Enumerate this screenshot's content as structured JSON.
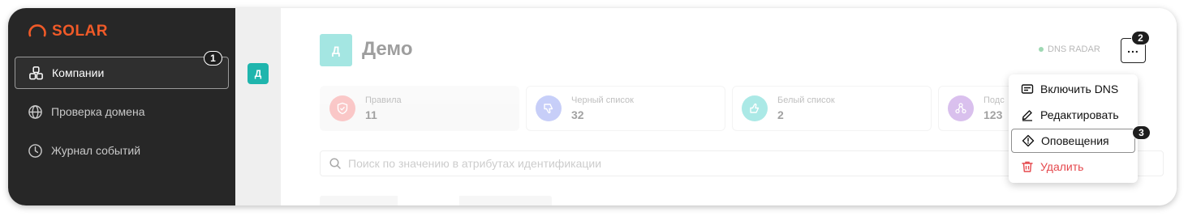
{
  "colors": {
    "accent": "#f05a28",
    "sidebar_bg": "#272727",
    "teal": "#26c3b9",
    "danger": "#e5484d",
    "status_ok": "#1aa34a"
  },
  "sidebar": {
    "logo": "SOLAR",
    "items": [
      {
        "label": "Компании",
        "icon": "blocks-icon",
        "active": true
      },
      {
        "label": "Проверка домена",
        "icon": "globe-icon"
      },
      {
        "label": "Журнал событий",
        "icon": "clock-icon"
      }
    ]
  },
  "slim": {
    "avatar_letter": "Д"
  },
  "header": {
    "avatar_letter": "Д",
    "title": "Демо",
    "status": "DNS RADAR"
  },
  "stats": [
    {
      "label": "Правила",
      "value": "11",
      "icon": "shield-icon",
      "color": "#f47c7c"
    },
    {
      "label": "Черный список",
      "value": "32",
      "icon": "thumb-down-icon",
      "color": "#7b8cf0"
    },
    {
      "label": "Белый список",
      "value": "2",
      "icon": "thumb-up-icon",
      "color": "#38cbc4"
    },
    {
      "label": "Подс",
      "value": "123",
      "icon": "network-icon",
      "color": "#a66ad6"
    }
  ],
  "search": {
    "placeholder": "Поиск по значению в атрибутах идентификации"
  },
  "menu": {
    "items": [
      {
        "label": "Включить DNS",
        "icon": "dns-card-icon"
      },
      {
        "label": "Редактировать",
        "icon": "pencil-icon"
      },
      {
        "label": "Оповещения",
        "icon": "alert-diamond-icon",
        "highlighted": true
      },
      {
        "label": "Удалить",
        "icon": "trash-icon",
        "danger": true
      }
    ]
  },
  "annotations": [
    "1",
    "2",
    "3"
  ]
}
